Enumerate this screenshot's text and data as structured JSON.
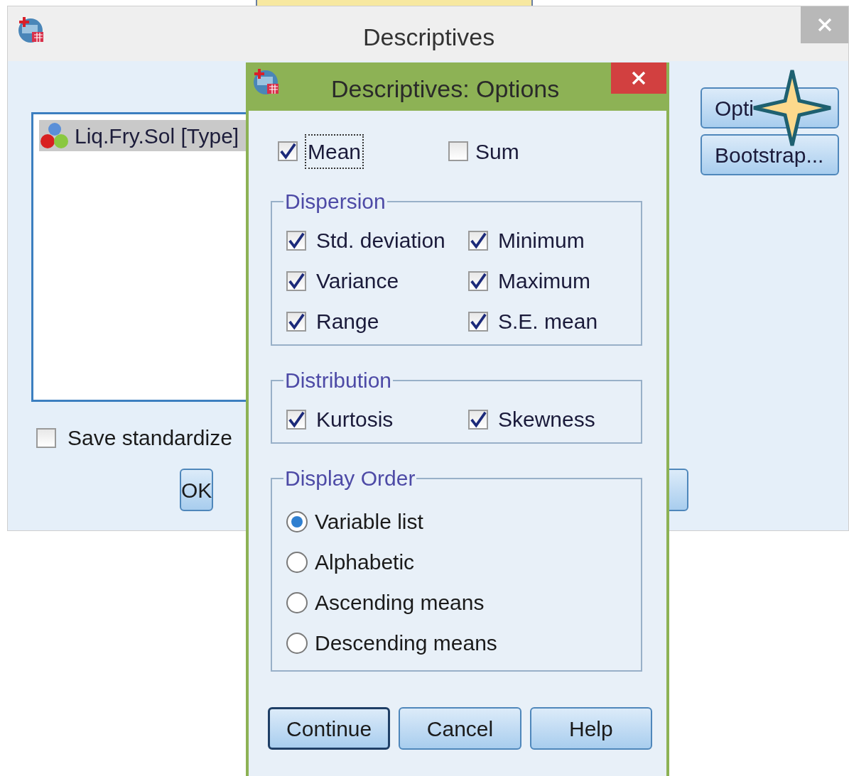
{
  "main_dialog": {
    "title": "Descriptives",
    "variables": [
      {
        "label": "Liq.Fry.Sol [Type]",
        "selected": true
      }
    ],
    "save_standardized": {
      "label": "Save standardize",
      "checked": false
    },
    "side_buttons": [
      "Opti",
      "Bootstrap..."
    ],
    "ok_button": "OK"
  },
  "options_dialog": {
    "title": "Descriptives: Options",
    "top": [
      {
        "label": "Mean",
        "checked": true
      },
      {
        "label": "Sum",
        "checked": false
      }
    ],
    "groups": [
      {
        "title": "Dispersion",
        "kind": "checks",
        "items": [
          {
            "label": "Std. deviation",
            "checked": true
          },
          {
            "label": "Minimum",
            "checked": true
          },
          {
            "label": "Variance",
            "checked": true
          },
          {
            "label": "Maximum",
            "checked": true
          },
          {
            "label": "Range",
            "checked": true
          },
          {
            "label": "S.E. mean",
            "checked": true
          }
        ]
      },
      {
        "title": "Distribution",
        "kind": "checks",
        "items": [
          {
            "label": "Kurtosis",
            "checked": true
          },
          {
            "label": "Skewness",
            "checked": true
          }
        ]
      },
      {
        "title": "Display Order",
        "kind": "radios",
        "items": [
          {
            "label": "Variable list",
            "selected": true
          },
          {
            "label": "Alphabetic",
            "selected": false
          },
          {
            "label": "Ascending means",
            "selected": false
          },
          {
            "label": "Descending means",
            "selected": false
          }
        ]
      }
    ],
    "buttons": [
      "Continue",
      "Cancel",
      "Help"
    ]
  }
}
